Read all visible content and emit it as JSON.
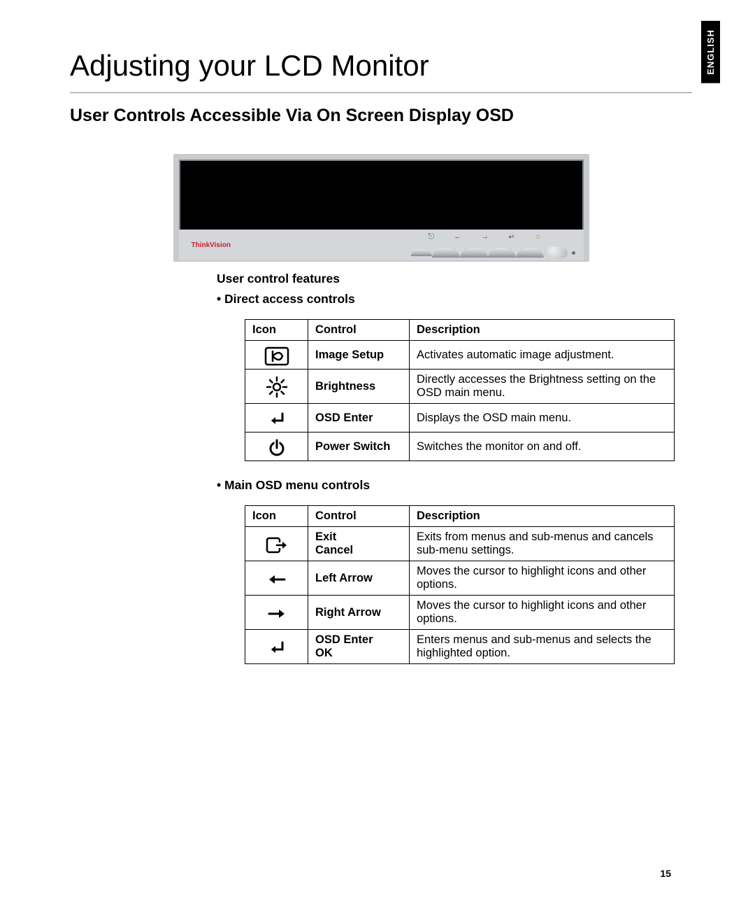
{
  "language_tab": "ENGLISH",
  "title": "Adjusting your LCD Monitor",
  "subtitle": "User Controls Accessible Via On Screen Display OSD",
  "monitor_brand": "ThinkVision",
  "features_heading": "User control features",
  "direct_access_heading": "Direct access controls",
  "main_osd_heading": "Main OSD menu controls",
  "table_headers": {
    "icon": "Icon",
    "control": "Control",
    "description": "Description"
  },
  "direct_access_controls": [
    {
      "icon": "image-setup-icon",
      "control": "Image Setup",
      "description": "Activates automatic image adjustment."
    },
    {
      "icon": "brightness-icon",
      "control": "Brightness",
      "description": "Directly accesses the Brightness setting on the OSD main menu."
    },
    {
      "icon": "enter-icon",
      "control": "OSD Enter",
      "description": "Displays the OSD main menu."
    },
    {
      "icon": "power-icon",
      "control": "Power Switch",
      "description": "Switches the monitor on and off."
    }
  ],
  "main_osd_controls": [
    {
      "icon": "exit-icon",
      "control": "Exit\nCancel",
      "description": "Exits from menus and sub-menus and cancels sub-menu settings."
    },
    {
      "icon": "left-arrow-icon",
      "control": "Left Arrow",
      "description": "Moves the cursor to highlight icons and other options."
    },
    {
      "icon": "right-arrow-icon",
      "control": "Right Arrow",
      "description": "Moves the cursor to highlight icons and other options."
    },
    {
      "icon": "enter-icon",
      "control": "OSD Enter\nOK",
      "description": "Enters menus and sub-menus and selects the highlighted option."
    }
  ],
  "page_number": "15"
}
